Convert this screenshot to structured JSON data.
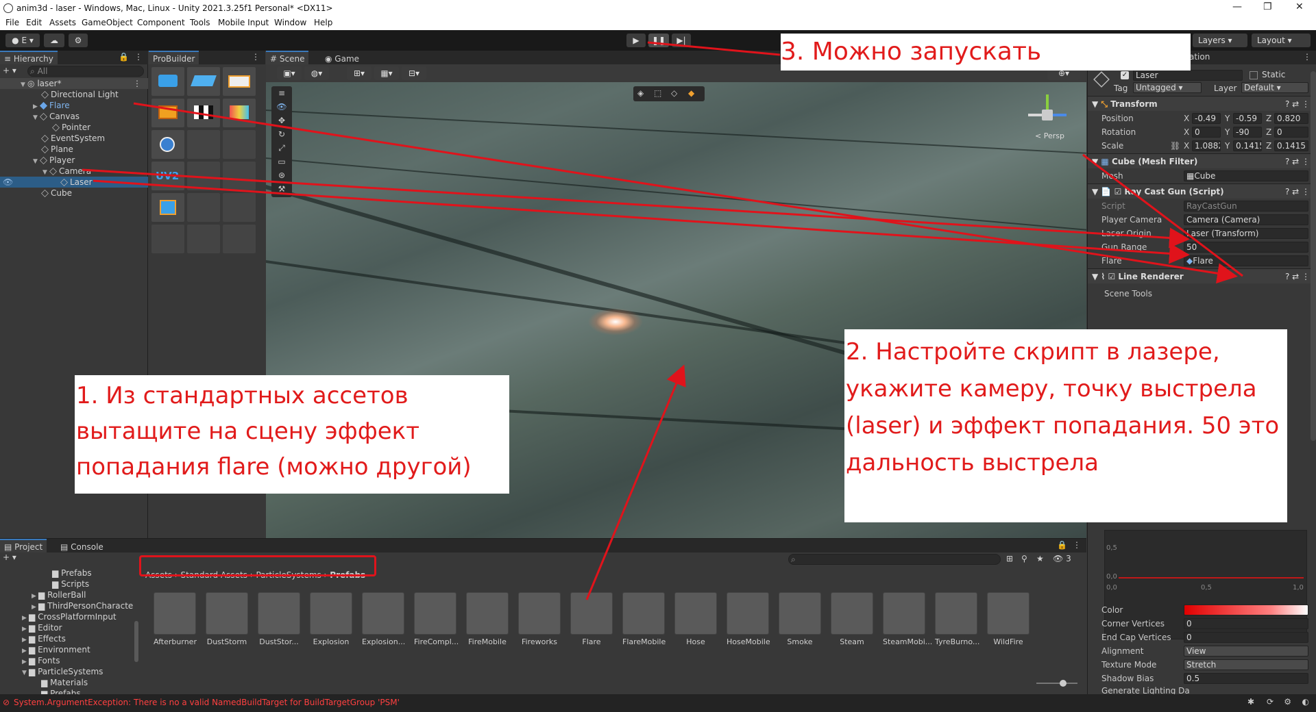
{
  "window": {
    "title": "anim3d - laser - Windows, Mac, Linux - Unity 2021.3.25f1 Personal* <DX11>",
    "controls": [
      "—",
      "❐",
      "✕"
    ]
  },
  "menu": [
    "File",
    "Edit",
    "Assets",
    "GameObject",
    "Component",
    "Tools",
    "Mobile Input",
    "Window",
    "Help"
  ],
  "toolbar": {
    "account": "E",
    "layers": "Layers",
    "layout": "Layout",
    "play": "▶",
    "pause": "❚❚",
    "step": "▶|"
  },
  "hierarchy": {
    "tab": "Hierarchy",
    "search_placeholder": "All",
    "items": [
      {
        "label": "laser*",
        "depth": 0
      },
      {
        "label": "Directional Light",
        "depth": 1
      },
      {
        "label": "Flare",
        "depth": 1
      },
      {
        "label": "Canvas",
        "depth": 1
      },
      {
        "label": "Pointer",
        "depth": 2
      },
      {
        "label": "EventSystem",
        "depth": 1
      },
      {
        "label": "Plane",
        "depth": 1
      },
      {
        "label": "Player",
        "depth": 1
      },
      {
        "label": "Camera",
        "depth": 2
      },
      {
        "label": "Laser",
        "depth": 3
      },
      {
        "label": "Cube",
        "depth": 1
      }
    ]
  },
  "probuilder": {
    "tab": "ProBuilder"
  },
  "scene": {
    "tabs": [
      "Scene",
      "Game"
    ],
    "persp": "< Persp"
  },
  "inspector": {
    "tab_partial": "ation",
    "object_name": "Laser",
    "static_label": "Static",
    "tag_label": "Tag",
    "tag_value": "Untagged",
    "layer_label": "Layer",
    "layer_value": "Default",
    "transform": {
      "title": "Transform",
      "position": {
        "label": "Position",
        "x": "-0.49",
        "y": "-0.59",
        "z": "0.820"
      },
      "rotation": {
        "label": "Rotation",
        "x": "0",
        "y": "-90",
        "z": "0"
      },
      "scale": {
        "label": "Scale",
        "x": "1.0882",
        "y": "0.1415",
        "z": "0.1415"
      }
    },
    "mesh_filter": {
      "title": "Cube (Mesh Filter)",
      "mesh_label": "Mesh",
      "mesh_value": "Cube"
    },
    "raycast": {
      "title": "Ray Cast Gun (Script)",
      "script_label": "Script",
      "script_value": "RayCastGun",
      "camera_label": "Player Camera",
      "camera_value": "Camera (Camera)",
      "origin_label": "Laser Origin",
      "origin_value": "Laser (Transform)",
      "range_label": "Gun Range",
      "range_value": "50",
      "flare_label": "Flare",
      "flare_value": "Flare"
    },
    "line_renderer": {
      "title": "Line Renderer",
      "scene_tools": "Scene Tools",
      "graph_ticks": {
        "y1": "0,5",
        "y0": "0,0",
        "x0": "0,0",
        "x05": "0,5",
        "x1": "1,0"
      },
      "props": [
        {
          "label": "Color",
          "value": ""
        },
        {
          "label": "Corner Vertices",
          "value": "0"
        },
        {
          "label": "End Cap Vertices",
          "value": "0"
        },
        {
          "label": "Alignment",
          "value": "View"
        },
        {
          "label": "Texture Mode",
          "value": "Stretch"
        },
        {
          "label": "Shadow Bias",
          "value": "0.5"
        },
        {
          "label": "Generate Lighting Da",
          "value": ""
        }
      ]
    }
  },
  "project": {
    "tabs": [
      "Project",
      "Console"
    ],
    "tree": [
      {
        "label": "Prefabs",
        "depth": 3
      },
      {
        "label": "Scripts",
        "depth": 3
      },
      {
        "label": "RollerBall",
        "depth": 2
      },
      {
        "label": "ThirdPersonCharacte",
        "depth": 2
      },
      {
        "label": "CrossPlatformInput",
        "depth": 1
      },
      {
        "label": "Editor",
        "depth": 1
      },
      {
        "label": "Effects",
        "depth": 1
      },
      {
        "label": "Environment",
        "depth": 1
      },
      {
        "label": "Fonts",
        "depth": 1
      },
      {
        "label": "ParticleSystems",
        "depth": 1
      },
      {
        "label": "Materials",
        "depth": 2
      },
      {
        "label": "Prefabs",
        "depth": 2
      }
    ],
    "breadcrumb": [
      "Assets",
      "Standard Assets",
      "ParticleSystems",
      "Prefabs"
    ],
    "hidden_count": "3",
    "assets": [
      "Afterburner",
      "DustStorm",
      "DustStor...",
      "Explosion",
      "Explosion...",
      "FireCompl...",
      "FireMobile",
      "Fireworks",
      "Flare",
      "FlareMobile",
      "Hose",
      "HoseMobile",
      "Smoke",
      "Steam",
      "SteamMobi...",
      "TyreBurno...",
      "WildFire"
    ]
  },
  "status": "System.ArgumentException: There is no a valid NamedBuildTarget for BuildTargetGroup 'PSM'",
  "annotations": {
    "note1": "1. Из стандартных ассетов вытащите на сцену эффект попадания flare (можно другой)",
    "note2": "2. Настройте скрипт в лазере, укажите камеру, точку выстрела (laser) и эффект попадания. 50 это дальность выстрела",
    "note3": "3. Можно запускать"
  },
  "colors": {
    "accent": "#e0131b",
    "selection": "#2c5d87"
  }
}
